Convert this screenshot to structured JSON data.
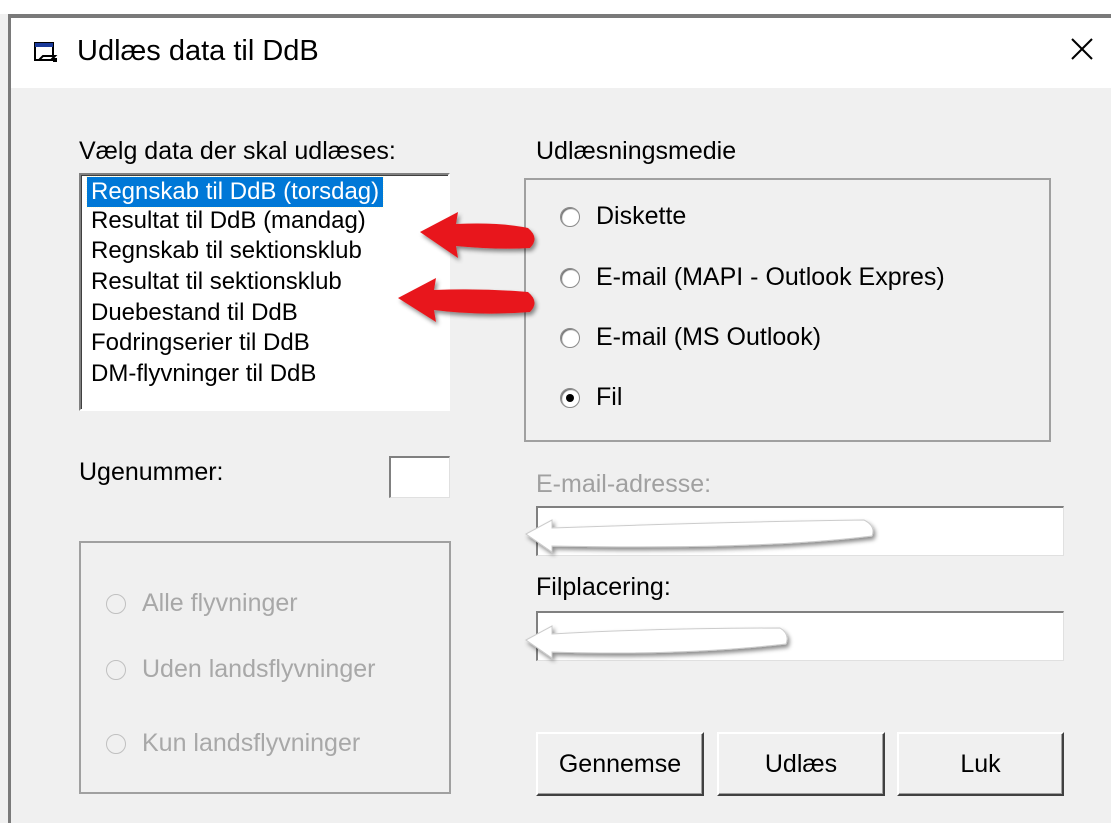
{
  "window": {
    "title": "Udlæs data til DdB",
    "close_symbol": "✕"
  },
  "data_select": {
    "label": "Vælg data der skal udlæses:",
    "items": [
      {
        "label": "Regnskab til DdB (torsdag)",
        "selected": true
      },
      {
        "label": "Resultat til DdB (mandag)",
        "selected": false
      },
      {
        "label": "Regnskab til sektionsklub",
        "selected": false
      },
      {
        "label": "Resultat til sektionsklub",
        "selected": false
      },
      {
        "label": "Duebestand til DdB",
        "selected": false
      },
      {
        "label": "Fodringserier til DdB",
        "selected": false
      },
      {
        "label": "DM-flyvninger til DdB",
        "selected": false
      }
    ]
  },
  "week": {
    "label": "Ugenummer:",
    "value": ""
  },
  "flight_filter": {
    "options": [
      {
        "label": "Alle flyvninger",
        "checked": false,
        "enabled": false
      },
      {
        "label": "Uden landsflyvninger",
        "checked": false,
        "enabled": false
      },
      {
        "label": "Kun landsflyvninger",
        "checked": false,
        "enabled": false
      }
    ]
  },
  "medium": {
    "label": "Udlæsningsmedie",
    "options": [
      {
        "label": "Diskette",
        "checked": false
      },
      {
        "label": "E-mail (MAPI - Outlook Expres)",
        "checked": false
      },
      {
        "label": "E-mail (MS Outlook)",
        "checked": false
      },
      {
        "label": "Fil",
        "checked": true
      }
    ]
  },
  "email": {
    "label": "E-mail-adresse:",
    "value": ""
  },
  "file": {
    "label": "Filplacering:",
    "value": ""
  },
  "buttons": {
    "browse": "Gennemse",
    "export": "Udlæs",
    "close": "Luk"
  },
  "annotations": {
    "red_arrow_color": "#e8191a",
    "white_arrow_color": "#ffffff"
  }
}
